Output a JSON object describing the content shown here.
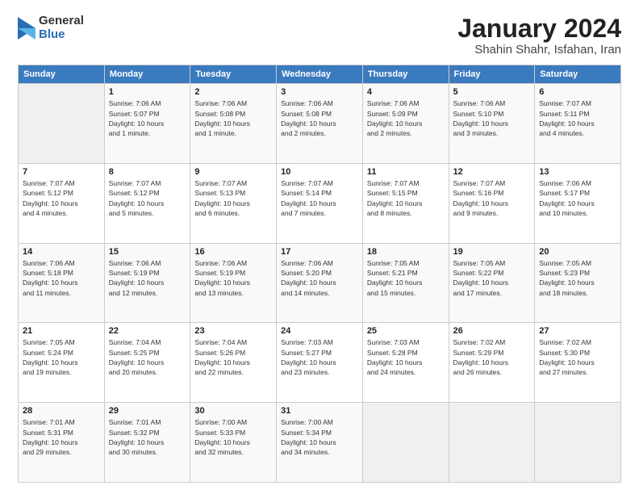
{
  "logo": {
    "general": "General",
    "blue": "Blue"
  },
  "title": "January 2024",
  "subtitle": "Shahin Shahr, Isfahan, Iran",
  "headers": [
    "Sunday",
    "Monday",
    "Tuesday",
    "Wednesday",
    "Thursday",
    "Friday",
    "Saturday"
  ],
  "weeks": [
    [
      {
        "day": "",
        "info": ""
      },
      {
        "day": "1",
        "info": "Sunrise: 7:06 AM\nSunset: 5:07 PM\nDaylight: 10 hours\nand 1 minute."
      },
      {
        "day": "2",
        "info": "Sunrise: 7:06 AM\nSunset: 5:08 PM\nDaylight: 10 hours\nand 1 minute."
      },
      {
        "day": "3",
        "info": "Sunrise: 7:06 AM\nSunset: 5:08 PM\nDaylight: 10 hours\nand 2 minutes."
      },
      {
        "day": "4",
        "info": "Sunrise: 7:06 AM\nSunset: 5:09 PM\nDaylight: 10 hours\nand 2 minutes."
      },
      {
        "day": "5",
        "info": "Sunrise: 7:06 AM\nSunset: 5:10 PM\nDaylight: 10 hours\nand 3 minutes."
      },
      {
        "day": "6",
        "info": "Sunrise: 7:07 AM\nSunset: 5:11 PM\nDaylight: 10 hours\nand 4 minutes."
      }
    ],
    [
      {
        "day": "7",
        "info": "Sunrise: 7:07 AM\nSunset: 5:12 PM\nDaylight: 10 hours\nand 4 minutes."
      },
      {
        "day": "8",
        "info": "Sunrise: 7:07 AM\nSunset: 5:12 PM\nDaylight: 10 hours\nand 5 minutes."
      },
      {
        "day": "9",
        "info": "Sunrise: 7:07 AM\nSunset: 5:13 PM\nDaylight: 10 hours\nand 6 minutes."
      },
      {
        "day": "10",
        "info": "Sunrise: 7:07 AM\nSunset: 5:14 PM\nDaylight: 10 hours\nand 7 minutes."
      },
      {
        "day": "11",
        "info": "Sunrise: 7:07 AM\nSunset: 5:15 PM\nDaylight: 10 hours\nand 8 minutes."
      },
      {
        "day": "12",
        "info": "Sunrise: 7:07 AM\nSunset: 5:16 PM\nDaylight: 10 hours\nand 9 minutes."
      },
      {
        "day": "13",
        "info": "Sunrise: 7:06 AM\nSunset: 5:17 PM\nDaylight: 10 hours\nand 10 minutes."
      }
    ],
    [
      {
        "day": "14",
        "info": "Sunrise: 7:06 AM\nSunset: 5:18 PM\nDaylight: 10 hours\nand 11 minutes."
      },
      {
        "day": "15",
        "info": "Sunrise: 7:06 AM\nSunset: 5:19 PM\nDaylight: 10 hours\nand 12 minutes."
      },
      {
        "day": "16",
        "info": "Sunrise: 7:06 AM\nSunset: 5:19 PM\nDaylight: 10 hours\nand 13 minutes."
      },
      {
        "day": "17",
        "info": "Sunrise: 7:06 AM\nSunset: 5:20 PM\nDaylight: 10 hours\nand 14 minutes."
      },
      {
        "day": "18",
        "info": "Sunrise: 7:05 AM\nSunset: 5:21 PM\nDaylight: 10 hours\nand 15 minutes."
      },
      {
        "day": "19",
        "info": "Sunrise: 7:05 AM\nSunset: 5:22 PM\nDaylight: 10 hours\nand 17 minutes."
      },
      {
        "day": "20",
        "info": "Sunrise: 7:05 AM\nSunset: 5:23 PM\nDaylight: 10 hours\nand 18 minutes."
      }
    ],
    [
      {
        "day": "21",
        "info": "Sunrise: 7:05 AM\nSunset: 5:24 PM\nDaylight: 10 hours\nand 19 minutes."
      },
      {
        "day": "22",
        "info": "Sunrise: 7:04 AM\nSunset: 5:25 PM\nDaylight: 10 hours\nand 20 minutes."
      },
      {
        "day": "23",
        "info": "Sunrise: 7:04 AM\nSunset: 5:26 PM\nDaylight: 10 hours\nand 22 minutes."
      },
      {
        "day": "24",
        "info": "Sunrise: 7:03 AM\nSunset: 5:27 PM\nDaylight: 10 hours\nand 23 minutes."
      },
      {
        "day": "25",
        "info": "Sunrise: 7:03 AM\nSunset: 5:28 PM\nDaylight: 10 hours\nand 24 minutes."
      },
      {
        "day": "26",
        "info": "Sunrise: 7:02 AM\nSunset: 5:29 PM\nDaylight: 10 hours\nand 26 minutes."
      },
      {
        "day": "27",
        "info": "Sunrise: 7:02 AM\nSunset: 5:30 PM\nDaylight: 10 hours\nand 27 minutes."
      }
    ],
    [
      {
        "day": "28",
        "info": "Sunrise: 7:01 AM\nSunset: 5:31 PM\nDaylight: 10 hours\nand 29 minutes."
      },
      {
        "day": "29",
        "info": "Sunrise: 7:01 AM\nSunset: 5:32 PM\nDaylight: 10 hours\nand 30 minutes."
      },
      {
        "day": "30",
        "info": "Sunrise: 7:00 AM\nSunset: 5:33 PM\nDaylight: 10 hours\nand 32 minutes."
      },
      {
        "day": "31",
        "info": "Sunrise: 7:00 AM\nSunset: 5:34 PM\nDaylight: 10 hours\nand 34 minutes."
      },
      {
        "day": "",
        "info": ""
      },
      {
        "day": "",
        "info": ""
      },
      {
        "day": "",
        "info": ""
      }
    ]
  ]
}
